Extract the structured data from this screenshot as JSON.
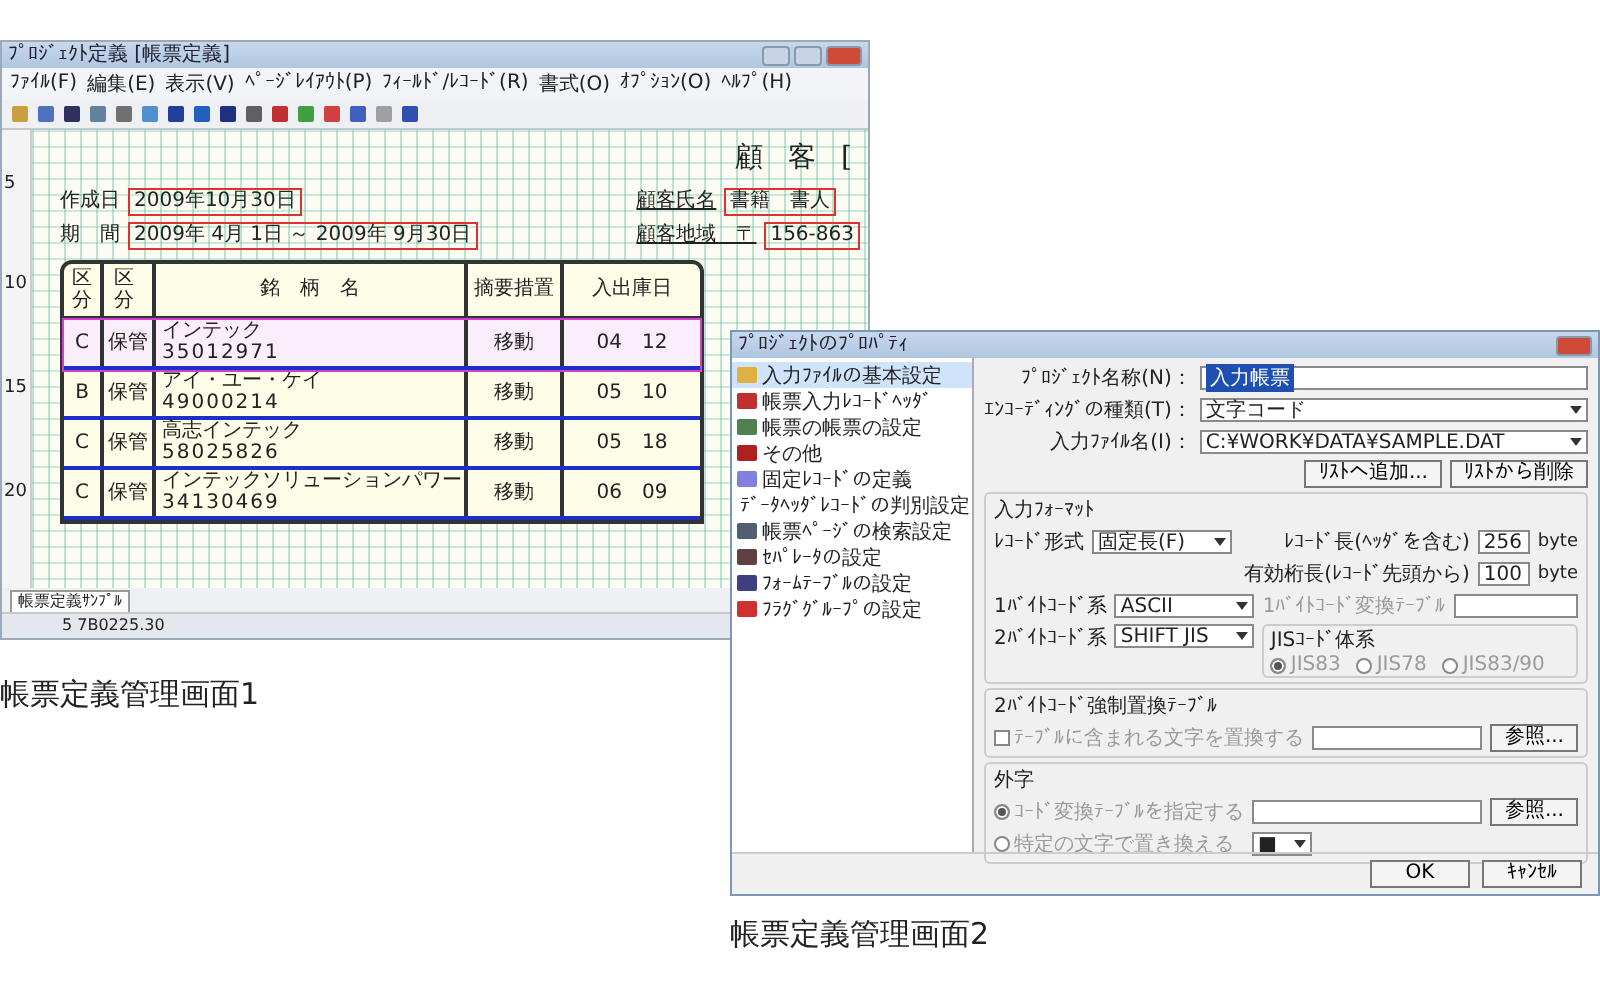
{
  "editor_window": {
    "title": "ﾌﾟﾛｼﾞｪｸﾄ定義 [帳票定義]",
    "menu": [
      "ﾌｧｲﾙ(F)",
      "編集(E)",
      "表示(V)",
      "ﾍﾟｰｼﾞﾚｲｱｳﾄ(P)",
      "ﾌｨｰﾙﾄﾞ/ﾚｺｰﾄﾞ(R)",
      "書式(O)",
      "ｵﾌﾟｼｮﾝ(O)",
      "ﾍﾙﾌﾟ(H)"
    ],
    "document": {
      "row_numbers": [
        "5",
        "10",
        "15",
        "20"
      ],
      "heading": "顧 客 [",
      "left_fields": [
        {
          "label": "作成日",
          "value": "2009年10月30日"
        },
        {
          "label": "期　間",
          "value": "2009年 4月 1日 ～ 2009年 9月30日"
        }
      ],
      "right_fields": [
        {
          "label": "顧客氏名",
          "value": "書籍　書人"
        },
        {
          "label": "顧客地域　〒",
          "value": "156-863"
        }
      ],
      "table": {
        "columns": [
          "区分",
          "区分",
          "銘　柄　名",
          "摘要措置",
          "入出庫日"
        ],
        "rows": [
          {
            "cells": [
              "C",
              "保管",
              "インテック",
              "移動",
              "04　12"
            ],
            "code": "35012971",
            "selected": true
          },
          {
            "cells": [
              "B",
              "保管",
              "アイ・ユー・ケイ",
              "移動",
              "05　10"
            ],
            "code": "49000214",
            "selected": false
          },
          {
            "cells": [
              "C",
              "保管",
              "高志インテック",
              "移動",
              "05　18"
            ],
            "code": "58025826",
            "selected": false
          },
          {
            "cells": [
              "C",
              "保管",
              "インテックソリューションパワー",
              "移動",
              "06　09"
            ],
            "code": "34130469",
            "selected": false
          }
        ]
      }
    },
    "sheet_tab": "帳票定義ｻﾝﾌﾟﾙ",
    "status": "5 7B0225.30"
  },
  "dialog": {
    "title": "ﾌﾟﾛｼﾞｪｸﾄのﾌﾟﾛﾊﾟﾃｨ",
    "sidebar": [
      {
        "label": "入力ﾌｧｲﾙの基本設定",
        "selected": true
      },
      {
        "label": "帳票入力ﾚｺｰﾄﾞﾍｯﾀﾞ",
        "selected": false
      },
      {
        "label": "帳票の帳票の設定",
        "selected": false
      },
      {
        "label": "その他",
        "selected": false
      },
      {
        "label": "固定ﾚｺｰﾄﾞの定義",
        "selected": false
      },
      {
        "label": "ﾃﾞｰﾀﾍｯﾀﾞﾚｺｰﾄﾞの判別設定",
        "selected": false
      },
      {
        "label": "帳票ﾍﾟｰｼﾞの検索設定",
        "selected": false
      },
      {
        "label": "ｾﾊﾟﾚｰﾀの設定",
        "selected": false
      },
      {
        "label": "ﾌｫｰﾑﾃｰﾌﾞﾙの設定",
        "selected": false
      },
      {
        "label": "ﾌﾗｸﾞｸﾞﾙｰﾌﾟの設定",
        "selected": false
      }
    ],
    "project_name": {
      "label": "ﾌﾟﾛｼﾞｪｸﾄ名称(N)：",
      "value": "入力帳票"
    },
    "encoding": {
      "label": "ｴﾝｺｰﾃﾞｨﾝｸﾞの種類(T)：",
      "value": "文字コード"
    },
    "input_file": {
      "label": "入力ﾌｧｲﾙ名(I)：",
      "value": "C:¥WORK¥DATA¥SAMPLE.DAT"
    },
    "list_buttons": [
      "ﾘｽﾄへ追加...",
      "ﾘｽﾄから削除"
    ],
    "input_format": {
      "title": "入力ﾌｫｰﾏｯﾄ",
      "record_type": {
        "label": "ﾚｺｰﾄﾞ形式",
        "value": "固定長(F)"
      },
      "record_length": {
        "label": "ﾚｺｰﾄﾞ長(ﾍｯﾀﾞを含む)",
        "value": "256",
        "unit": "byte"
      },
      "valid_length": {
        "label": "有効桁長(ﾚｺｰﾄﾞ先頭から)",
        "value": "100",
        "unit": "byte"
      },
      "single_byte": {
        "label": "1ﾊﾞｲﾄｺｰﾄﾞ系",
        "value": "ASCII"
      },
      "single_table": {
        "label": "1ﾊﾞｲﾄｺｰﾄﾞ変換ﾃｰﾌﾞﾙ",
        "disabled": true
      },
      "double_byte": {
        "label": "2ﾊﾞｲﾄｺｰﾄﾞ系",
        "value": "SHIFT JIS"
      },
      "jis": {
        "title": "JISｺｰﾄﾞ体系",
        "options": [
          {
            "label": "JIS83",
            "selected": true
          },
          {
            "label": "JIS78",
            "selected": false
          },
          {
            "label": "JIS83/90",
            "selected": false
          }
        ],
        "disabled": true
      }
    },
    "replace_table": {
      "title": "2ﾊﾞｲﾄｺｰﾄﾞ強制置換ﾃｰﾌﾞﾙ",
      "option": {
        "label": "ﾃｰﾌﾞﾙに含まれる文字を置換する",
        "checked": false
      },
      "button": "参照...",
      "disabled": true
    },
    "gaiji": {
      "title": "外字",
      "options": [
        {
          "label": "ｺｰﾄﾞ変換ﾃｰﾌﾞﾙを指定する",
          "selected": true,
          "kind": "file"
        },
        {
          "label": "特定の文字で置き換える",
          "selected": false,
          "kind": "char",
          "value": "■"
        }
      ],
      "button": "参照...",
      "disabled": true
    },
    "buttons": [
      "OK",
      "ｷｬﾝｾﾙ"
    ]
  },
  "captions": [
    "帳票定義管理画面1",
    "帳票定義管理画面2"
  ]
}
